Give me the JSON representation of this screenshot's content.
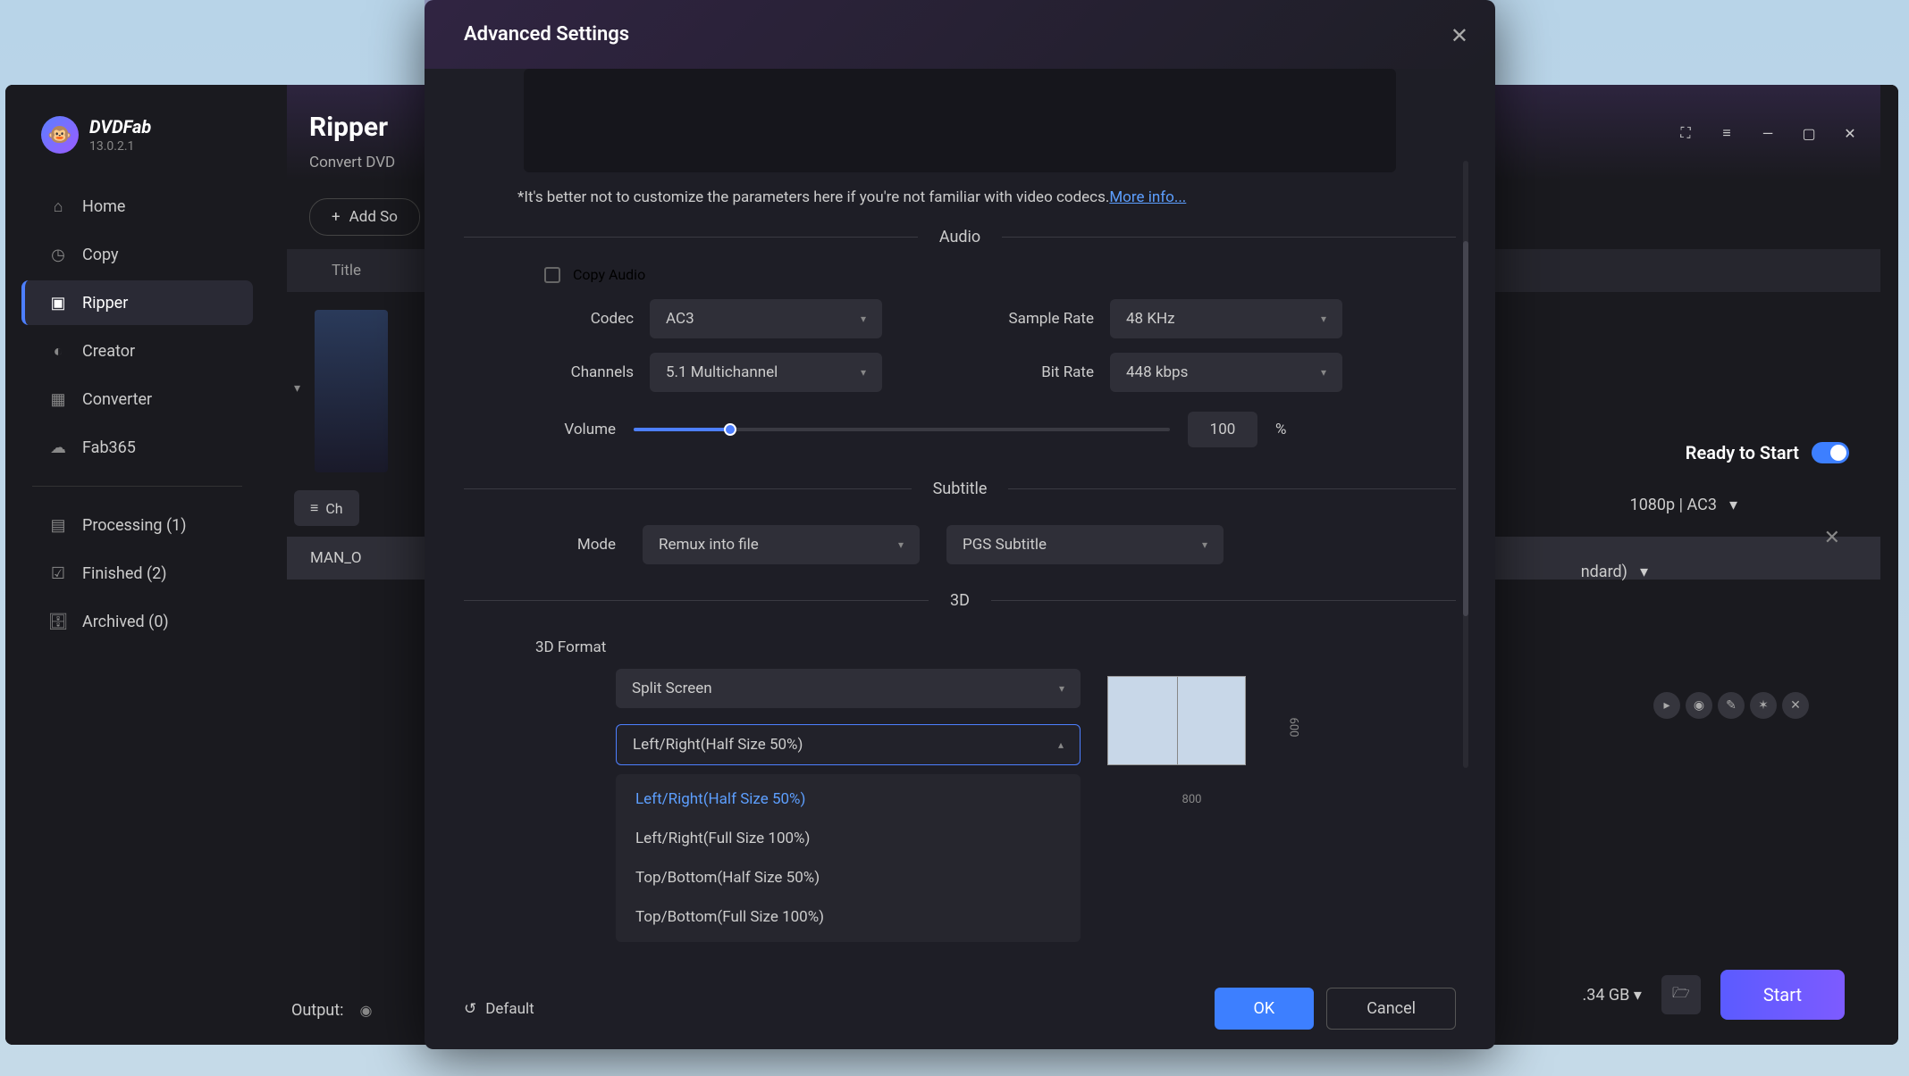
{
  "app": {
    "brand": "DVDFab",
    "version": "13.0.2.1"
  },
  "sidebar": {
    "items": [
      {
        "icon": "home",
        "label": "Home"
      },
      {
        "icon": "copy",
        "label": "Copy"
      },
      {
        "icon": "ripper",
        "label": "Ripper"
      },
      {
        "icon": "creator",
        "label": "Creator"
      },
      {
        "icon": "converter",
        "label": "Converter"
      },
      {
        "icon": "fab365",
        "label": "Fab365"
      }
    ],
    "status": [
      {
        "label": "Processing (1)"
      },
      {
        "label": "Finished (2)"
      },
      {
        "label": "Archived (0)"
      }
    ]
  },
  "page": {
    "title": "Ripper",
    "subtitle": "Convert DVD",
    "add_source": "Add So",
    "title_header": "Title",
    "choose_other": "Ch",
    "file_name": "MAN_O",
    "output_label": "Output:"
  },
  "right": {
    "ready": "Ready to Start",
    "format": "1080p | AC3",
    "ndard": "ndard)",
    "size": ".34 GB",
    "start": "Start"
  },
  "modal": {
    "title": "Advanced Settings",
    "info_text": "*It's better not to customize the parameters here if you're not familiar with video codecs.",
    "info_link": "More info...",
    "sections": {
      "audio": "Audio",
      "subtitle": "Subtitle",
      "threeD": "3D"
    },
    "audio": {
      "copy_label": "Copy Audio",
      "codec_label": "Codec",
      "codec_value": "AC3",
      "sample_label": "Sample Rate",
      "sample_value": "48 KHz",
      "channels_label": "Channels",
      "channels_value": "5.1 Multichannel",
      "bitrate_label": "Bit Rate",
      "bitrate_value": "448 kbps",
      "volume_label": "Volume",
      "volume_value": "100",
      "volume_pct": "%"
    },
    "subtitle": {
      "mode_label": "Mode",
      "mode_value": "Remux into file",
      "type_value": "PGS Subtitle"
    },
    "threeD": {
      "format_label": "3D Format",
      "split_value": "Split Screen",
      "lr_value": "Left/Right(Half Size 50%)",
      "options": [
        "Left/Right(Half Size 50%)",
        "Left/Right(Full Size 100%)",
        "Top/Bottom(Half Size 50%)",
        "Top/Bottom(Full Size 100%)"
      ],
      "dim_w": "800",
      "dim_h": "600"
    },
    "footer": {
      "default": "Default",
      "ok": "OK",
      "cancel": "Cancel"
    }
  }
}
